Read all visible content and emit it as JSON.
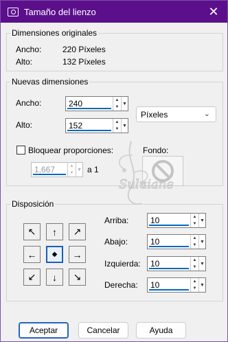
{
  "window": {
    "title": "Tamaño del lienzo",
    "close_glyph": "✕"
  },
  "original": {
    "group_label": "Dimensiones originales",
    "width_label": "Ancho:",
    "width_value": "220 Píxeles",
    "height_label": "Alto:",
    "height_value": "132 Píxeles"
  },
  "new_dims": {
    "group_label": "Nuevas dimensiones",
    "width_label": "Ancho:",
    "width_value": "240",
    "height_label": "Alto:",
    "height_value": "152",
    "units": "Píxeles",
    "lock_label": "Bloquear proporciones:",
    "lock_checked": false,
    "ratio_value": "1,667",
    "ratio_suffix": "a 1",
    "background_label": "Fondo:"
  },
  "position": {
    "group_label": "Disposición",
    "anchors": [
      {
        "name": "anchor-top-left",
        "glyph": "↖"
      },
      {
        "name": "anchor-top",
        "glyph": "↑"
      },
      {
        "name": "anchor-top-right",
        "glyph": "↗"
      },
      {
        "name": "anchor-left",
        "glyph": "←"
      },
      {
        "name": "anchor-center",
        "glyph": "◆"
      },
      {
        "name": "anchor-right",
        "glyph": "→"
      },
      {
        "name": "anchor-bottom-left",
        "glyph": "↙"
      },
      {
        "name": "anchor-bottom",
        "glyph": "↓"
      },
      {
        "name": "anchor-bottom-right",
        "glyph": "↘"
      }
    ],
    "selected_anchor": "anchor-center",
    "top_label": "Arriba:",
    "top_value": "10",
    "bottom_label": "Abajo:",
    "bottom_value": "10",
    "left_label": "Izquierda:",
    "left_value": "10",
    "right_label": "Derecha:",
    "right_value": "10"
  },
  "buttons": {
    "ok": "Aceptar",
    "cancel": "Cancelar",
    "help": "Ayuda"
  },
  "watermark": {
    "text": "Suluiane"
  },
  "colors": {
    "titlebar": "#5c0f8b",
    "accent": "#0067c0"
  }
}
